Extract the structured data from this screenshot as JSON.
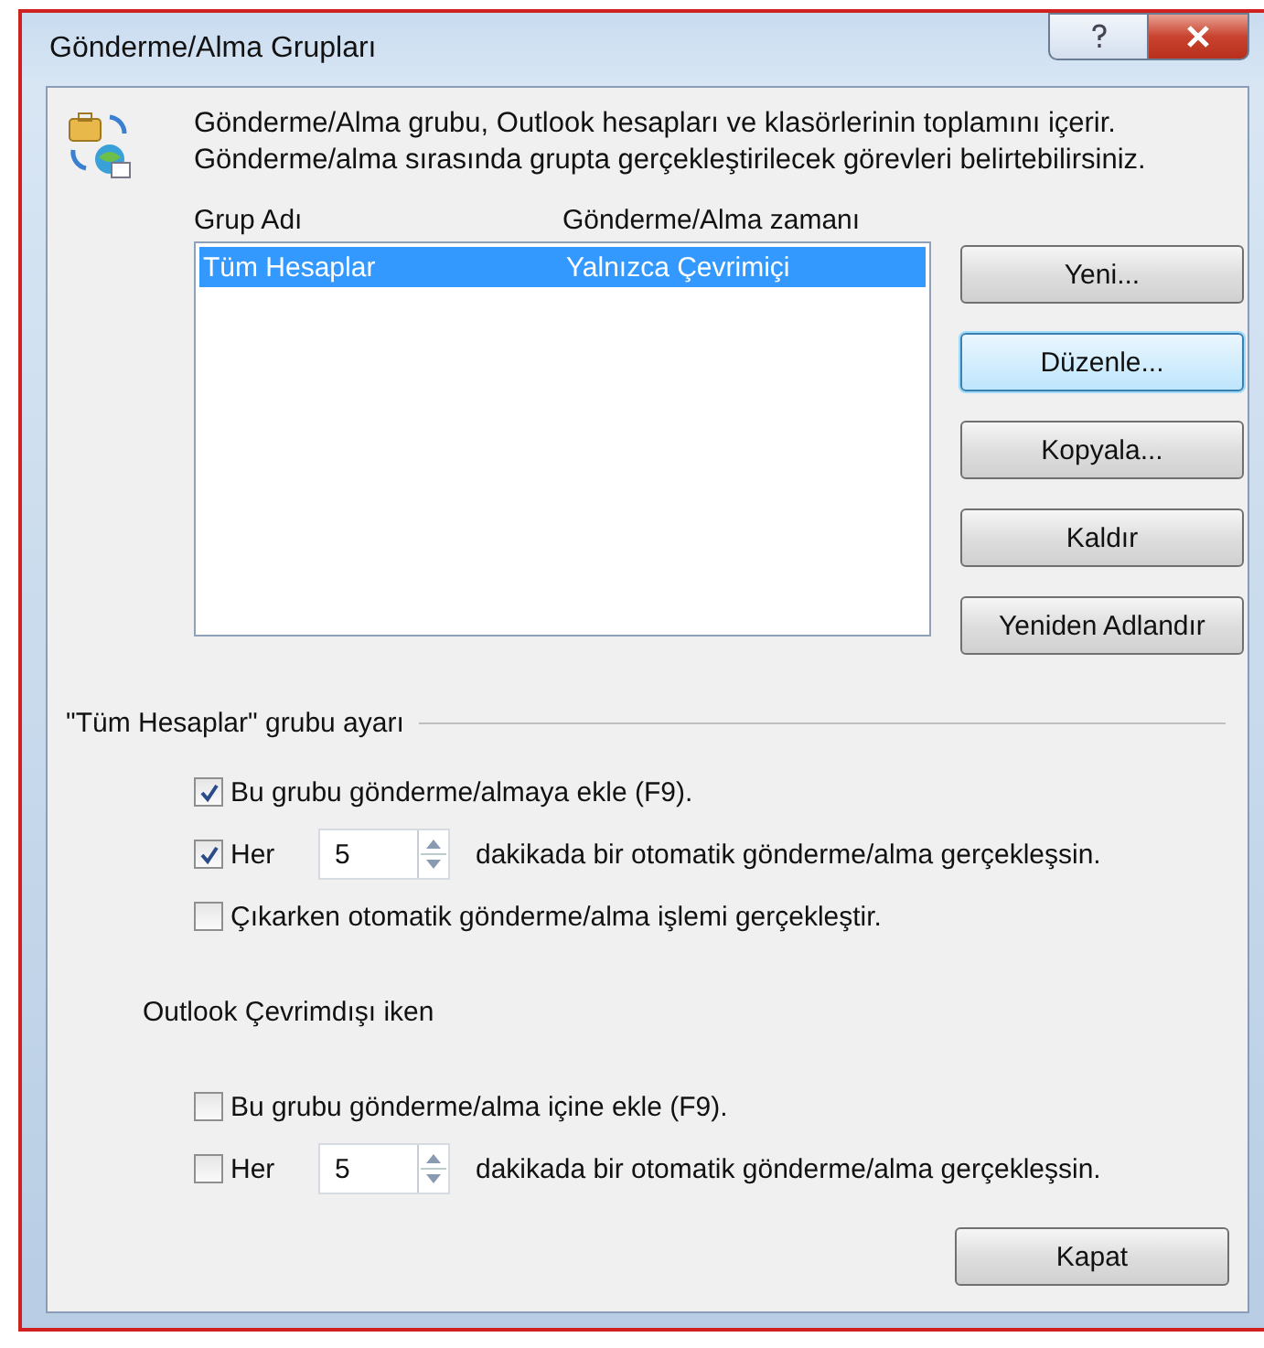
{
  "window": {
    "title": "Gönderme/Alma Grupları"
  },
  "description_lines": [
    "Gönderme/Alma grubu, Outlook hesapları ve klasörlerinin toplamını içerir.",
    "Gönderme/alma sırasında grupta gerçekleştirilecek görevleri belirtebilirsiniz."
  ],
  "groups_table": {
    "columns": [
      "Grup Adı",
      "Gönderme/Alma zamanı"
    ],
    "rows": [
      {
        "cells": [
          "Tüm Hesaplar",
          "Yalnızca Çevrimiçi"
        ],
        "selected": true
      }
    ]
  },
  "side_buttons": [
    {
      "label": "Yeni...",
      "focused": false
    },
    {
      "label": "Düzenle...",
      "focused": true
    },
    {
      "label": "Kopyala...",
      "focused": false
    },
    {
      "label": "Kaldır",
      "focused": false
    },
    {
      "label": "Yeniden Adlandır",
      "focused": false
    }
  ],
  "sections": [
    {
      "title": "\"Tüm Hesaplar\" grubu ayarı",
      "kind": "fieldset",
      "options": [
        {
          "kind": "checkbox",
          "label": "Bu grubu gönderme/almaya ekle (F9).",
          "checked": true
        },
        {
          "kind": "interval",
          "label": "Her",
          "checked": true,
          "value": "5",
          "suffix": "dakikada bir otomatik gönderme/alma gerçekleşsin."
        },
        {
          "kind": "checkbox",
          "label": "Çıkarken otomatik gönderme/alma işlemi gerçekleştir.",
          "checked": false
        }
      ]
    },
    {
      "title": "Outlook Çevrimdışı iken",
      "kind": "plain",
      "options": [
        {
          "kind": "checkbox",
          "label": "Bu grubu gönderme/alma içine ekle (F9).",
          "checked": false
        },
        {
          "kind": "interval",
          "label": "Her",
          "checked": false,
          "value": "5",
          "suffix": "dakikada bir otomatik gönderme/alma gerçekleşsin."
        }
      ]
    }
  ],
  "close_button": "Kapat"
}
